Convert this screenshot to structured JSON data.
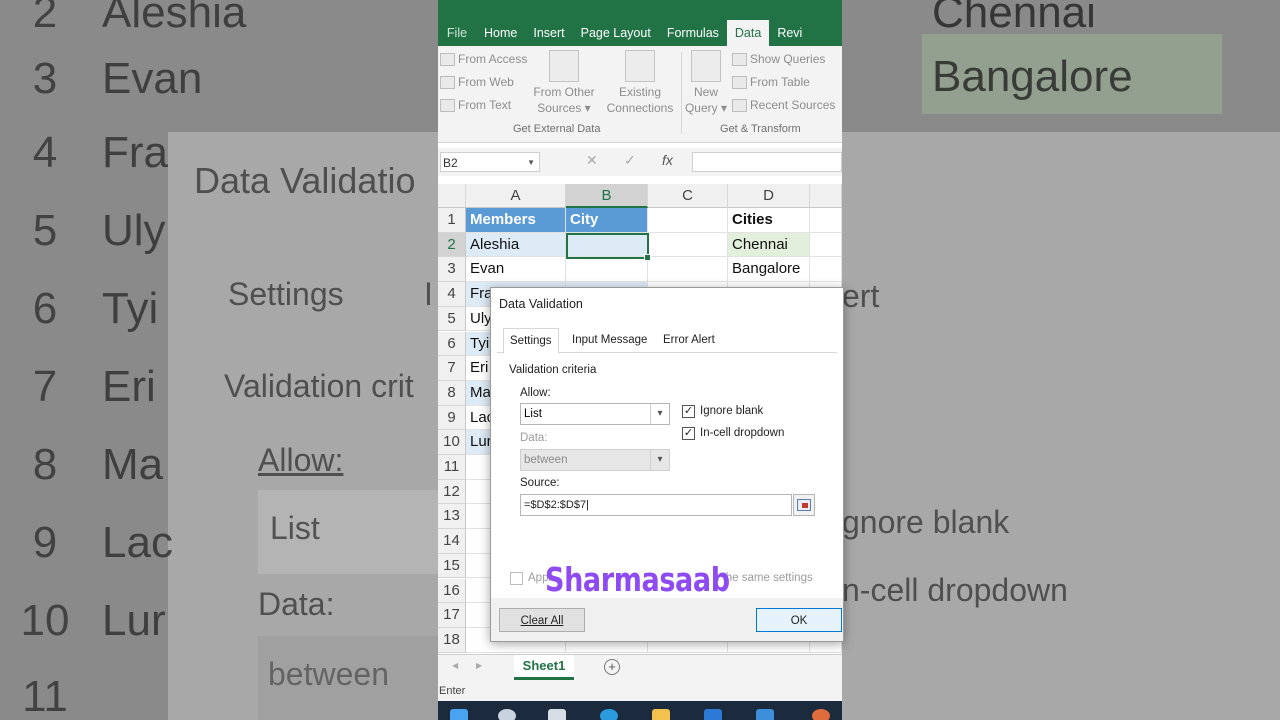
{
  "ribbon": {
    "tabs": [
      "File",
      "Home",
      "Insert",
      "Page Layout",
      "Formulas",
      "Data",
      "Revi"
    ],
    "active_tab": "Data",
    "get_external": {
      "from_access": "From Access",
      "from_web": "From Web",
      "from_text": "From Text",
      "from_other_sources_1": "From Other",
      "from_other_sources_2": "Sources",
      "existing_connections_1": "Existing",
      "existing_connections_2": "Connections",
      "group_label": "Get External Data"
    },
    "get_transform": {
      "new_query_1": "New",
      "new_query_2": "Query",
      "show_queries": "Show Queries",
      "from_table": "From Table",
      "recent_sources": "Recent Sources",
      "group_label": "Get & Transform"
    }
  },
  "formula_bar": {
    "name_box": "B2",
    "cancel": "✕",
    "enter": "✓",
    "fx": "fx"
  },
  "grid": {
    "columns": [
      "A",
      "B",
      "C",
      "D"
    ],
    "rows": [
      "1",
      "2",
      "3",
      "4",
      "5",
      "6",
      "7",
      "8",
      "9",
      "10",
      "11",
      "12",
      "13",
      "14",
      "15",
      "16",
      "17",
      "18"
    ],
    "cells": {
      "A1": "Members",
      "B1": "City",
      "D1": "Cities",
      "A2": "Aleshia",
      "D2": "Chennai",
      "A3": "Evan",
      "D3": "Bangalore",
      "A4": "Fra",
      "A5": "Uly",
      "A6": "Tyi",
      "A7": "Eri",
      "A8": "Ma",
      "A9": "Lac",
      "A10": "Lur"
    }
  },
  "sheet": {
    "tab": "Sheet1",
    "add": "+"
  },
  "status": {
    "mode": "Enter"
  },
  "dialog": {
    "title": "Data Validation",
    "tabs": [
      "Settings",
      "Input Message",
      "Error Alert"
    ],
    "active_tab": "Settings",
    "section": "Validation criteria",
    "allow_label": "Allow:",
    "allow_value": "List",
    "data_label": "Data:",
    "data_value": "between",
    "ignore_blank": "Ignore blank",
    "in_cell_dropdown": "In-cell dropdown",
    "source_label": "Source:",
    "source_value": "=$D$2:$D$7",
    "apply_left": "Appl",
    "apply_right": "h the same settings",
    "clear_all": "Clear All",
    "ok": "OK"
  },
  "watermark": "Sharmasaab",
  "background": {
    "rows": [
      "2",
      "3",
      "4",
      "5",
      "6",
      "7",
      "8",
      "9",
      "10",
      "11"
    ],
    "names": [
      "Aleshia",
      "Evan",
      "Fra",
      "Uly",
      "Tyi",
      "Eri",
      "Ma",
      "Lac",
      "Lur"
    ],
    "dialog_title": "Data Validatio",
    "settings": "Settings",
    "validation_criteria": "Validation crit",
    "allow": "Allow:",
    "list": "List",
    "data": "Data:",
    "between": "between",
    "city_top": "Chennai",
    "city_2": "Bangalore",
    "ignore_blank": "gnore blank",
    "in_cell": "n-cell dropdown",
    "alert": "ert",
    "i_frag": "I"
  },
  "colors": {
    "excel_green": "#217346",
    "header_blue": "#5b9bd5",
    "band_blue": "#ddebf7",
    "city_green": "#e2efda",
    "watermark": "#8f4bf2"
  }
}
